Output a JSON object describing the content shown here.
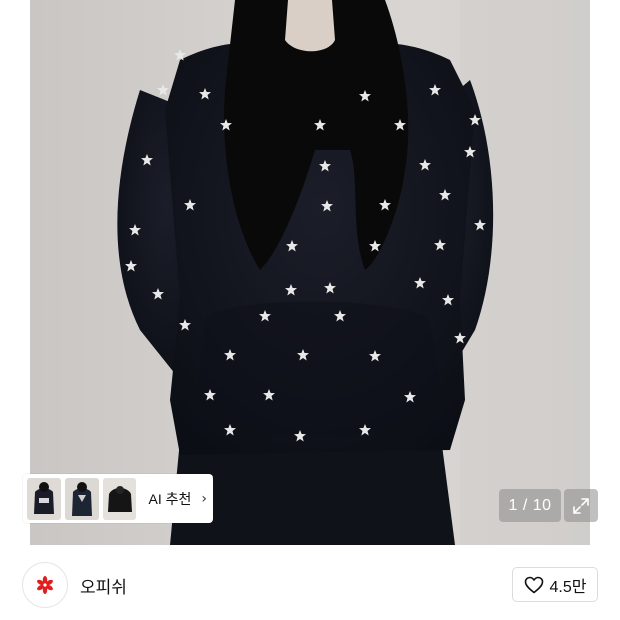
{
  "gallery": {
    "ai_recommend_label": "AI 추천",
    "ai_chevron": "›",
    "pager_text": "1 / 10",
    "expand_icon": "expand-icon",
    "thumbnails": [
      "thumb-1",
      "thumb-2",
      "thumb-3"
    ]
  },
  "brand": {
    "name": "오피쉬",
    "logo_icon": "flower-icon",
    "logo_color": "#e01e1e"
  },
  "like": {
    "icon": "heart-icon",
    "count": "4.5만"
  },
  "colors": {
    "hoodie": "#14161f",
    "stars": "#e8e8e8",
    "backdrop": "#d3d0cd"
  }
}
